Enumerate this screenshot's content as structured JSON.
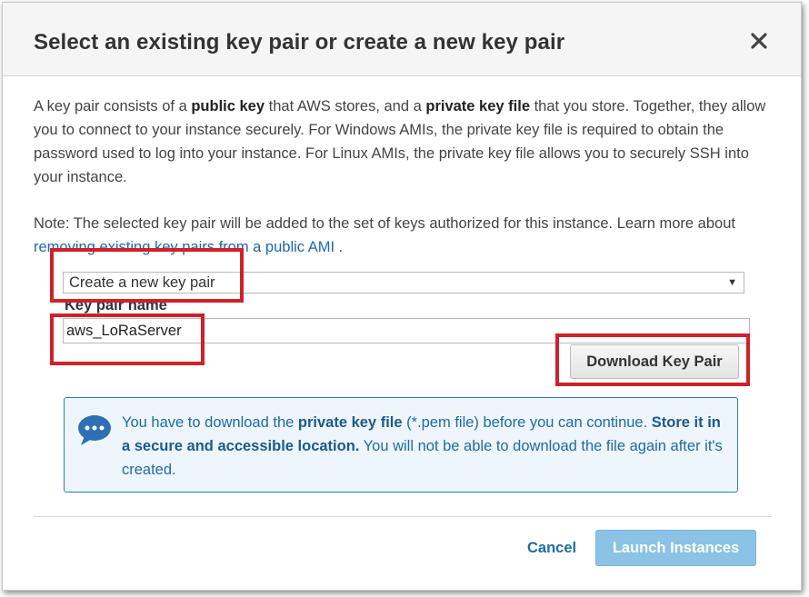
{
  "dialog": {
    "title": "Select an existing key pair or create a new key pair",
    "close_icon": "close-icon"
  },
  "description": {
    "part1": "A key pair consists of a ",
    "bold1": "public key",
    "part2": " that AWS stores, and a ",
    "bold2": "private key file",
    "part3": " that you store. Together, they allow you to connect to your instance securely. For Windows AMIs, the private key file is required to obtain the password used to log into your instance. For Linux AMIs, the private key file allows you to securely SSH into your instance."
  },
  "note": {
    "text": "Note: The selected key pair will be added to the set of keys authorized for this instance. Learn more about ",
    "link": "removing existing key pairs from a public AMI",
    "end": " ."
  },
  "key_pair_select": {
    "selected": "Create a new key pair"
  },
  "key_pair_name": {
    "label": "Key pair name",
    "value": "aws_LoRaServer"
  },
  "download_button": {
    "label": "Download Key Pair"
  },
  "info_box": {
    "icon": "chat-bubble-icon",
    "part1": "You have to download the ",
    "bold1": "private key file",
    "part2": " (*.pem file) before you can continue. ",
    "bold2": "Store it in a secure and accessible location.",
    "part3": " You will not be able to download the file again after it's created."
  },
  "footer": {
    "cancel_label": "Cancel",
    "launch_label": "Launch Instances"
  },
  "colors": {
    "highlight_red": "#d0202a",
    "link_blue": "#1f6aa5",
    "launch_button": "#8cc2e6"
  }
}
